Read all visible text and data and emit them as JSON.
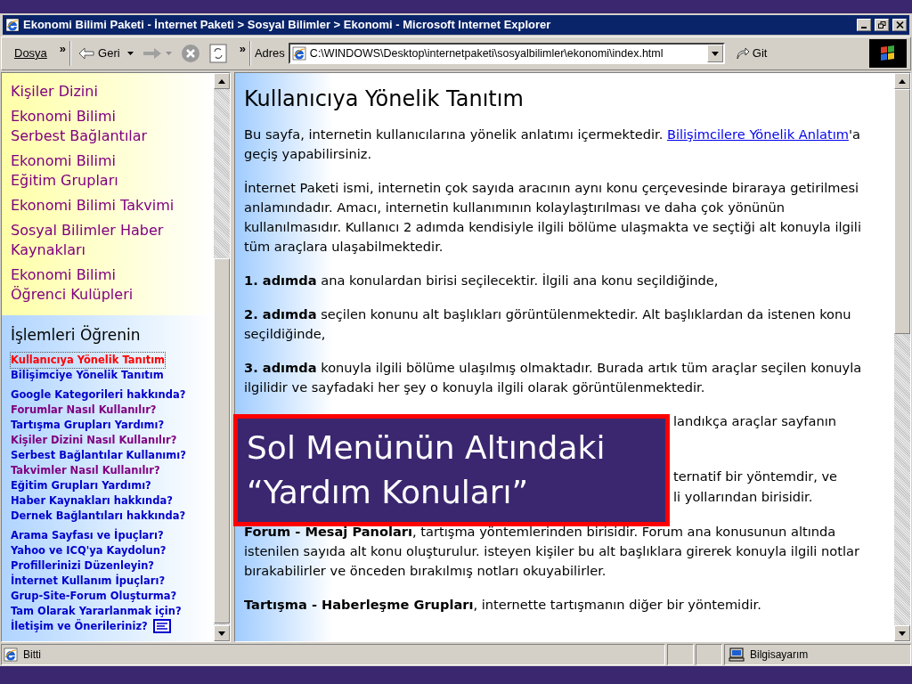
{
  "window": {
    "title": "Ekonomi Bilimi Paketi - İnternet Paketi > Sosyal Bilimler > Ekonomi - Microsoft Internet Explorer"
  },
  "toolbar": {
    "menu": "Dosya",
    "chevron": "»",
    "back": "Geri",
    "chevron2": "»",
    "address_label": "Adres",
    "address": "C:\\WINDOWS\\Desktop\\internetpaketi\\sosyalbilimler\\ekonomi\\index.html",
    "go": "Git"
  },
  "menu": {
    "items": [
      {
        "lines": [
          "Kişiler Dizini"
        ]
      },
      {
        "lines": [
          "Ekonomi Bilimi",
          "Serbest Bağlantılar"
        ]
      },
      {
        "lines": [
          "Ekonomi Bilimi",
          "Eğitim Grupları"
        ]
      },
      {
        "lines": [
          "Ekonomi Bilimi Takvimi"
        ]
      },
      {
        "lines": [
          "Sosyal Bilimler Haber",
          "Kaynakları"
        ]
      },
      {
        "lines": [
          "Ekonomi Bilimi",
          "Öğrenci Kulüpleri"
        ]
      }
    ],
    "help_title": "İşlemleri Öğrenin",
    "help_groups": [
      [
        {
          "label": "Kullanıcıya Yönelik Tanıtım",
          "kind": "active"
        },
        {
          "label": "Bilişimciye Yönelik Tanıtım",
          "kind": "link"
        }
      ],
      [
        {
          "label": "Google Kategorileri hakkında?",
          "kind": "link"
        },
        {
          "label": "Forumlar Nasıl Kullanılır?",
          "kind": "visited"
        },
        {
          "label": "Tartışma Grupları Yardımı?",
          "kind": "link"
        },
        {
          "label": "Kişiler Dizini Nasıl Kullanılır?",
          "kind": "visited"
        },
        {
          "label": "Serbest Bağlantılar Kullanımı?",
          "kind": "link"
        },
        {
          "label": "Takvimler Nasıl Kullanılır?",
          "kind": "visited"
        },
        {
          "label": "Eğitim Grupları Yardımı?",
          "kind": "link"
        },
        {
          "label": "Haber Kaynakları hakkında?",
          "kind": "link"
        },
        {
          "label": "Dernek Bağlantıları hakkında?",
          "kind": "link"
        }
      ],
      [
        {
          "label": "Arama Sayfası ve İpuçları?",
          "kind": "link"
        },
        {
          "label": "Yahoo ve ICQ'ya Kaydolun?",
          "kind": "link"
        },
        {
          "label": "Profillerinizi Düzenleyin?",
          "kind": "link"
        },
        {
          "label": "İnternet Kullanım İpuçları?",
          "kind": "link"
        },
        {
          "label": "Grup-Site-Forum Oluşturma?",
          "kind": "link"
        },
        {
          "label": "Tam Olarak Yararlanmak için?",
          "kind": "link"
        },
        {
          "label": "İletişim ve Önerileriniz?",
          "kind": "link"
        }
      ]
    ]
  },
  "content": {
    "heading": "Kullanıcıya Yönelik Tanıtım",
    "paragraphs": [
      {
        "kind": "link_text",
        "before": "Bu sayfa, internetin kullanıcılarına yönelik anlatımı içermektedir. ",
        "link": "Bilişimcilere Yönelik Anlatım",
        "after": "'a geçiş yapabilirsiniz."
      },
      {
        "kind": "text",
        "text": "İnternet Paketi ismi, internetin çok sayıda aracının aynı konu çerçevesinde biraraya getirilmesi anlamındadır. Amacı, internetin kullanımının kolaylaştırılması ve daha çok yönünün kullanılmasıdır. Kullanıcı 2 adımda kendisiyle ilgili bölüme ulaşmakta ve seçtiği alt konuyla ilgili tüm araçlara ulaşabilmektedir."
      },
      {
        "kind": "text",
        "text": "**1. adımda** ana konulardan birisi seçilecektir. İlgili ana konu seçildiğinde,"
      },
      {
        "kind": "text",
        "text": "**2. adımda** seçilen konunu alt başlıkları görüntülenmektedir. Alt başlıklardan da istenen konu seçildiğinde,"
      },
      {
        "kind": "text",
        "text": "**3. adımda** konuyla ilgili bölüme ulaşılmış olmaktadır. Burada artık tüm araçlar seçilen konuyla ilgilidir ve sayfadaki her şey o konuyla ilgili olarak görüntülenmektedir."
      },
      {
        "kind": "fragments",
        "lines": [
          "landıkça araçlar sayfanın"
        ]
      },
      {
        "kind": "fragments",
        "lines": [
          "ternatif bir yöntemdir, ve",
          "li yollarından birisidir."
        ]
      },
      {
        "kind": "text",
        "text": "**Forum - Mesaj Panoları**, tartışma yöntemlerinden birisidir. Forum ana konusunun altında istenilen sayıda alt konu oluşturulur. isteyen kişiler bu alt başlıklara girerek konuyla ilgili notlar bırakabilirler ve önceden bırakılmış notları okuyabilirler."
      },
      {
        "kind": "text",
        "text": "**Tartışma - Haberleşme Grupları**, internette tartışmanın diğer bir yöntemidir."
      }
    ]
  },
  "callout": {
    "lines": [
      "Sol Menünün Altındaki",
      "“Yardım Konuları”"
    ]
  },
  "status_bar": {
    "text": "Bitti",
    "zone": "Bilgisayarım"
  }
}
